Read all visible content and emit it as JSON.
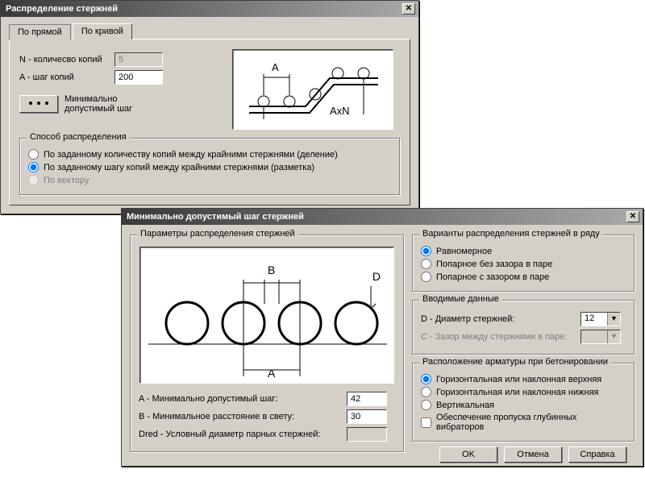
{
  "win1": {
    "title": "Распределение стержней",
    "tabs": {
      "straight": "По прямой",
      "curve": "По кривой"
    },
    "form": {
      "n_label": "N - количесво копий",
      "n_value": "5",
      "a_label": "A - шаг копий",
      "a_value": "200",
      "min_step_btn_label": "Минимально допустимый шаг"
    },
    "dist": {
      "legend": "Способ распределения",
      "opt1": "По заданному количеству копий между крайними стержнями (деление)",
      "opt2": "По заданному шагу копий между крайними стержнями (разметка)",
      "opt3": "По вектору"
    },
    "diagram": {
      "A": "A",
      "AxN": "AxN"
    }
  },
  "win2": {
    "title": "Минимально допустимый шаг стержней",
    "params": {
      "legend": "Параметры распределения стержней",
      "diagram": {
        "A": "A",
        "B": "B",
        "D": "D"
      },
      "a_label": "A - Минимально допустимый шаг:",
      "a_value": "42",
      "b_label": "B - Минимальное расстояние в свету:",
      "b_value": "30",
      "dred_label": "Dred - Условный диаметр парных стержней:",
      "dred_value": ""
    },
    "variants": {
      "legend": "Варианты распределения стержней в ряду",
      "opt1": "Равномерное",
      "opt2": "Попарное без зазора в паре",
      "opt3": "Попарное с зазором в паре"
    },
    "input": {
      "legend": "Вводимые данные",
      "d_label": "D -  Диаметр стержней:",
      "d_value": "12",
      "c_label": "C -  Зазор между стержнями в паре:",
      "c_value": ""
    },
    "layout": {
      "legend": "Расположение арматуры при бетонировании",
      "opt1": "Горизонтальная или наклонная верхняя",
      "opt2": "Горизонтальная или наклонная нижняя",
      "opt3": "Вертикальная",
      "chk": "Обеспечение пропуска глубинных вибраторов"
    },
    "buttons": {
      "ok": "OK",
      "cancel": "Отмена",
      "help": "Справка"
    }
  }
}
